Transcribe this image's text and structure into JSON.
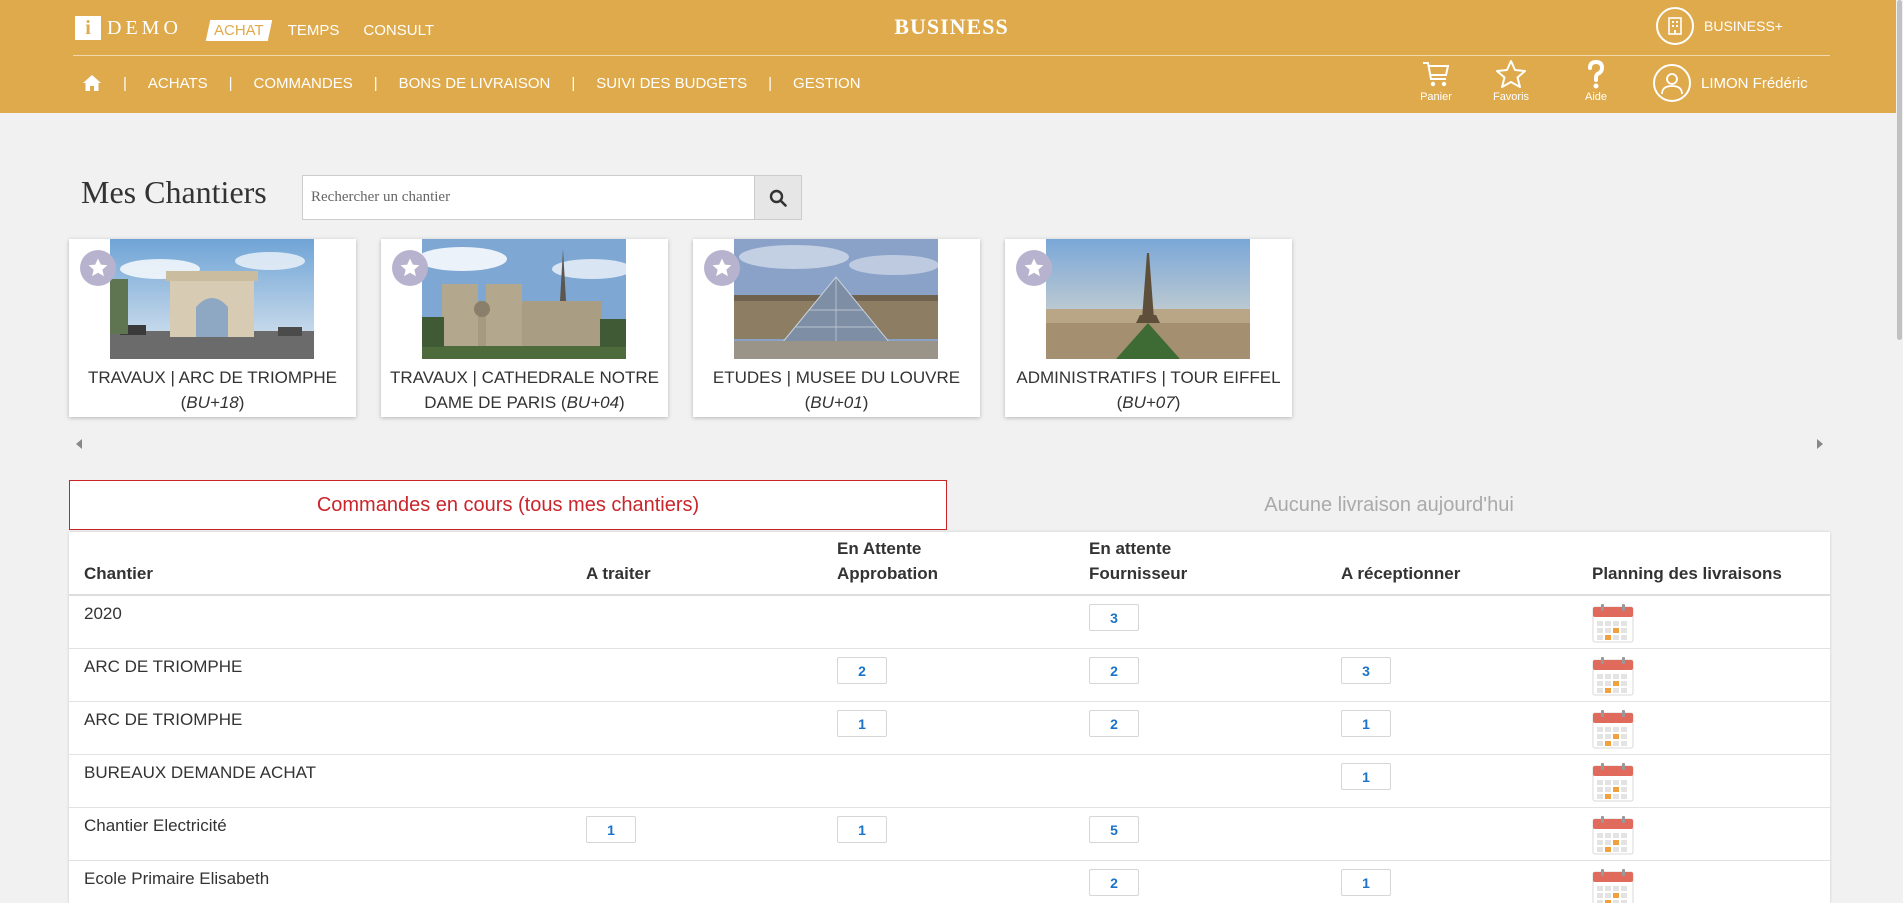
{
  "header": {
    "logo_i": "i",
    "logo_text": "DEMO",
    "top_tabs": [
      "ACHAT",
      "TEMPS",
      "CONSULT"
    ],
    "brand": "BUSINESS",
    "business_plus": "BUSINESS+",
    "nav": [
      "ACHATS",
      "COMMANDES",
      "BONS DE LIVRAISON",
      "SUIVI DES BUDGETS",
      "GESTION"
    ],
    "nav_sep": "|",
    "tools": {
      "cart": "Panier",
      "favorites": "Favoris",
      "help": "Aide"
    },
    "user": "LIMON Frédéric",
    "colors": {
      "bar": "#dfaa4b",
      "accent_red": "#c9252b",
      "badge_blue": "#1a73c9"
    }
  },
  "page": {
    "title": "Mes Chantiers",
    "search_placeholder": "Rechercher un chantier"
  },
  "cards": [
    {
      "line1": "TRAVAUX | ARC DE TRIOMPHE",
      "line2_pre": "(",
      "code": "BU+18",
      "line2_post": ")"
    },
    {
      "line1": "TRAVAUX | CATHEDRALE NOTRE",
      "line2_pre": "DAME DE PARIS (",
      "code": "BU+04",
      "line2_post": ")"
    },
    {
      "line1": "ETUDES | MUSEE DU LOUVRE",
      "line2_pre": "(",
      "code": "BU+01",
      "line2_post": ")"
    },
    {
      "line1": "ADMINISTRATIFS | TOUR EIFFEL",
      "line2_pre": "(",
      "code": "BU+07",
      "line2_post": ")"
    }
  ],
  "tabs": {
    "active": "Commandes en cours (tous mes chantiers)",
    "inactive": "Aucune livraison aujourd'hui"
  },
  "table": {
    "headers": {
      "chantier": "Chantier",
      "a_traiter": "A traiter",
      "approbation_1": "En Attente",
      "approbation_2": "Approbation",
      "fournisseur_1": "En attente",
      "fournisseur_2": "Fournisseur",
      "receptionner": "A réceptionner",
      "planning": "Planning des livraisons"
    },
    "rows": [
      {
        "name": "2020",
        "a_traiter": "",
        "approbation": "",
        "fournisseur": "3",
        "receptionner": ""
      },
      {
        "name": "ARC DE TRIOMPHE",
        "a_traiter": "",
        "approbation": "2",
        "fournisseur": "2",
        "receptionner": "3"
      },
      {
        "name": "ARC DE TRIOMPHE",
        "a_traiter": "",
        "approbation": "1",
        "fournisseur": "2",
        "receptionner": "1"
      },
      {
        "name": "BUREAUX DEMANDE ACHAT",
        "a_traiter": "",
        "approbation": "",
        "fournisseur": "",
        "receptionner": "1"
      },
      {
        "name": "Chantier Electricité",
        "a_traiter": "1",
        "approbation": "1",
        "fournisseur": "5",
        "receptionner": ""
      },
      {
        "name": "Ecole Primaire Elisabeth",
        "a_traiter": "",
        "approbation": "",
        "fournisseur": "2",
        "receptionner": "1"
      }
    ]
  }
}
